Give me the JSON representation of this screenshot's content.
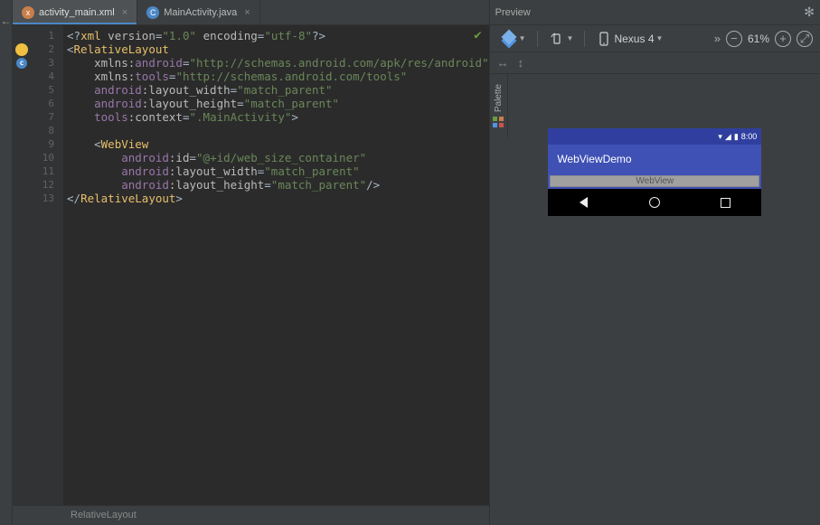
{
  "tabs": [
    {
      "label": "activity_main.xml",
      "icon": "x",
      "active": true
    },
    {
      "label": "MainActivity.java",
      "icon": "C",
      "active": false
    }
  ],
  "code": {
    "lines": [
      [
        [
          "t-punc",
          "<?"
        ],
        [
          "t-tag",
          "xml"
        ],
        [
          "t-def",
          " "
        ],
        [
          "t-attr",
          "version"
        ],
        [
          "t-punc",
          "="
        ],
        [
          "t-val",
          "\"1.0\""
        ],
        [
          "t-def",
          " "
        ],
        [
          "t-attr",
          "encoding"
        ],
        [
          "t-punc",
          "="
        ],
        [
          "t-val",
          "\"utf-8\""
        ],
        [
          "t-punc",
          "?>"
        ]
      ],
      [
        [
          "t-punc",
          "<"
        ],
        [
          "t-tag",
          "RelativeLayout"
        ]
      ],
      [
        [
          "t-def",
          "    "
        ],
        [
          "t-attr",
          "xmlns:"
        ],
        [
          "t-ns",
          "android"
        ],
        [
          "t-punc",
          "="
        ],
        [
          "t-val",
          "\"http://schemas.android.com/apk/res/android\""
        ]
      ],
      [
        [
          "t-def",
          "    "
        ],
        [
          "t-attr",
          "xmlns:"
        ],
        [
          "t-ns",
          "tools"
        ],
        [
          "t-punc",
          "="
        ],
        [
          "t-val",
          "\"http://schemas.android.com/tools\""
        ]
      ],
      [
        [
          "t-def",
          "    "
        ],
        [
          "t-ns",
          "android"
        ],
        [
          "t-attr",
          ":layout_width"
        ],
        [
          "t-punc",
          "="
        ],
        [
          "t-val",
          "\"match_parent\""
        ]
      ],
      [
        [
          "t-def",
          "    "
        ],
        [
          "t-ns",
          "android"
        ],
        [
          "t-attr",
          ":layout_height"
        ],
        [
          "t-punc",
          "="
        ],
        [
          "t-val",
          "\"match_parent\""
        ]
      ],
      [
        [
          "t-def",
          "    "
        ],
        [
          "t-ns",
          "tools"
        ],
        [
          "t-attr",
          ":context"
        ],
        [
          "t-punc",
          "="
        ],
        [
          "t-val",
          "\".MainActivity\""
        ],
        [
          "t-punc",
          ">"
        ]
      ],
      [],
      [
        [
          "t-def",
          "    "
        ],
        [
          "t-punc",
          "<"
        ],
        [
          "t-tag",
          "WebView"
        ]
      ],
      [
        [
          "t-def",
          "        "
        ],
        [
          "t-ns",
          "android"
        ],
        [
          "t-attr",
          ":id"
        ],
        [
          "t-punc",
          "="
        ],
        [
          "t-val",
          "\"@+id/web_size_container\""
        ]
      ],
      [
        [
          "t-def",
          "        "
        ],
        [
          "t-ns",
          "android"
        ],
        [
          "t-attr",
          ":layout_width"
        ],
        [
          "t-punc",
          "="
        ],
        [
          "t-val",
          "\"match_parent\""
        ]
      ],
      [
        [
          "t-def",
          "        "
        ],
        [
          "t-ns",
          "android"
        ],
        [
          "t-attr",
          ":layout_height"
        ],
        [
          "t-punc",
          "="
        ],
        [
          "t-val",
          "\"match_parent\""
        ],
        [
          "t-punc",
          "/>"
        ]
      ],
      [
        [
          "t-punc",
          "</"
        ],
        [
          "t-tag",
          "RelativeLayout"
        ],
        [
          "t-punc",
          ">"
        ]
      ]
    ]
  },
  "breadcrumb": "RelativeLayout",
  "preview": {
    "title": "Preview",
    "device": "Nexus 4",
    "zoom": "61%",
    "status_time": "8:00",
    "app_title": "WebViewDemo",
    "webview_label": "WebView",
    "palette": "Palette"
  }
}
